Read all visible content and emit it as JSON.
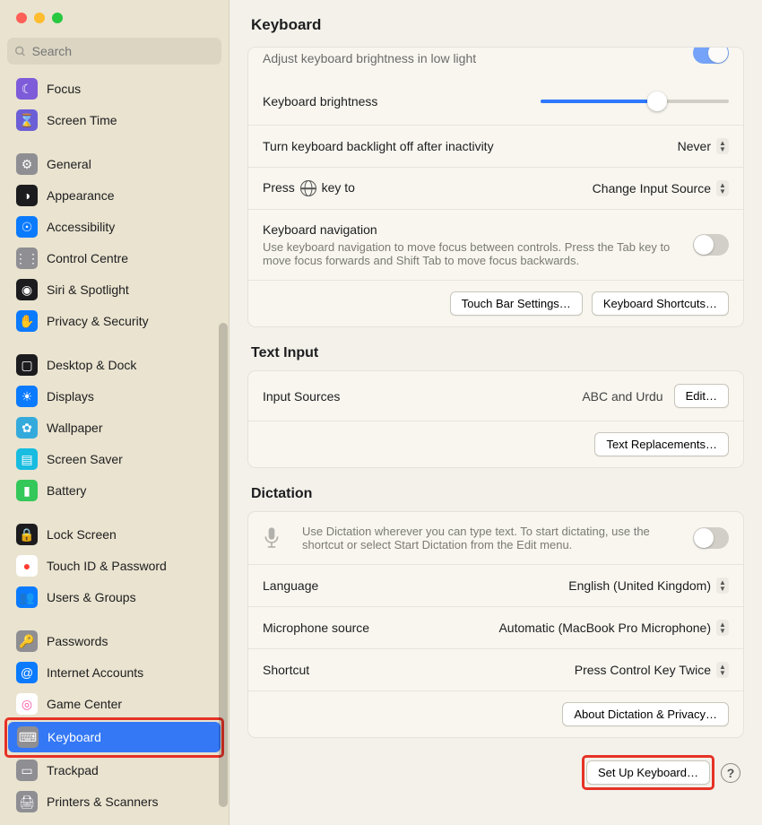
{
  "window": {
    "title": "Keyboard"
  },
  "search": {
    "placeholder": "Search"
  },
  "sidebar": {
    "items": [
      {
        "label": "Focus",
        "icon_bg": "#7d5bd9",
        "glyph": "☾"
      },
      {
        "label": "Screen Time",
        "icon_bg": "#6b5ed6",
        "glyph": "⌛"
      },
      {
        "_spacer": true
      },
      {
        "label": "General",
        "icon_bg": "#8e8e93",
        "glyph": "⚙"
      },
      {
        "label": "Appearance",
        "icon_bg": "#1c1c1e",
        "glyph": "◑"
      },
      {
        "label": "Accessibility",
        "icon_bg": "#0a7aff",
        "glyph": "☉"
      },
      {
        "label": "Control Centre",
        "icon_bg": "#8e8e93",
        "glyph": "⋮⋮"
      },
      {
        "label": "Siri & Spotlight",
        "icon_bg": "#1c1c1e",
        "glyph": "◉"
      },
      {
        "label": "Privacy & Security",
        "icon_bg": "#0a7aff",
        "glyph": "✋"
      },
      {
        "_spacer": true
      },
      {
        "label": "Desktop & Dock",
        "icon_bg": "#1c1c1e",
        "glyph": "▢"
      },
      {
        "label": "Displays",
        "icon_bg": "#0a7aff",
        "glyph": "☀"
      },
      {
        "label": "Wallpaper",
        "icon_bg": "#34aadc",
        "glyph": "✿"
      },
      {
        "label": "Screen Saver",
        "icon_bg": "#17bce0",
        "glyph": "▤"
      },
      {
        "label": "Battery",
        "icon_bg": "#34c759",
        "glyph": "▮"
      },
      {
        "_spacer": true
      },
      {
        "label": "Lock Screen",
        "icon_bg": "#1c1c1e",
        "glyph": "🔒"
      },
      {
        "label": "Touch ID & Password",
        "icon_bg": "#ffffff",
        "glyph": "●",
        "glyph_color": "#ff3b30"
      },
      {
        "label": "Users & Groups",
        "icon_bg": "#0a7aff",
        "glyph": "👥"
      },
      {
        "_spacer": true
      },
      {
        "label": "Passwords",
        "icon_bg": "#8e8e93",
        "glyph": "🔑"
      },
      {
        "label": "Internet Accounts",
        "icon_bg": "#0a7aff",
        "glyph": "@"
      },
      {
        "label": "Game Center",
        "icon_bg": "#ffffff",
        "glyph": "◎",
        "glyph_color": "#ff4fa3"
      },
      {
        "label": "Keyboard",
        "icon_bg": "#8e8e93",
        "glyph": "⌨",
        "selected": true,
        "highlight": true
      },
      {
        "label": "Trackpad",
        "icon_bg": "#8e8e93",
        "glyph": "▭"
      },
      {
        "label": "Printers & Scanners",
        "icon_bg": "#8e8e93",
        "glyph": "🖨"
      }
    ]
  },
  "main": {
    "cutoff_row": "Adjust keyboard brightness in low light",
    "keyboard_card": {
      "brightness_label": "Keyboard brightness",
      "brightness_percent": 62,
      "backlight_label": "Turn keyboard backlight off after inactivity",
      "backlight_value": "Never",
      "press_pre": "Press ",
      "press_post": " key to",
      "press_value": "Change Input Source",
      "nav_label": "Keyboard navigation",
      "nav_desc": "Use keyboard navigation to move focus between controls. Press the Tab key to move focus forwards and Shift Tab to move focus backwards.",
      "touchbar_btn": "Touch Bar Settings…",
      "shortcuts_btn": "Keyboard Shortcuts…"
    },
    "text_input": {
      "title": "Text Input",
      "sources_label": "Input Sources",
      "sources_value": "ABC and Urdu",
      "edit_btn": "Edit…",
      "replacements_btn": "Text Replacements…"
    },
    "dictation": {
      "title": "Dictation",
      "desc": "Use Dictation wherever you can type text. To start dictating, use the shortcut or select Start Dictation from the Edit menu.",
      "language_label": "Language",
      "language_value": "English (United Kingdom)",
      "mic_label": "Microphone source",
      "mic_value": "Automatic (MacBook Pro Microphone)",
      "shortcut_label": "Shortcut",
      "shortcut_value": "Press Control Key Twice",
      "about_btn": "About Dictation & Privacy…"
    },
    "footer": {
      "setup_btn": "Set Up Keyboard…"
    }
  }
}
